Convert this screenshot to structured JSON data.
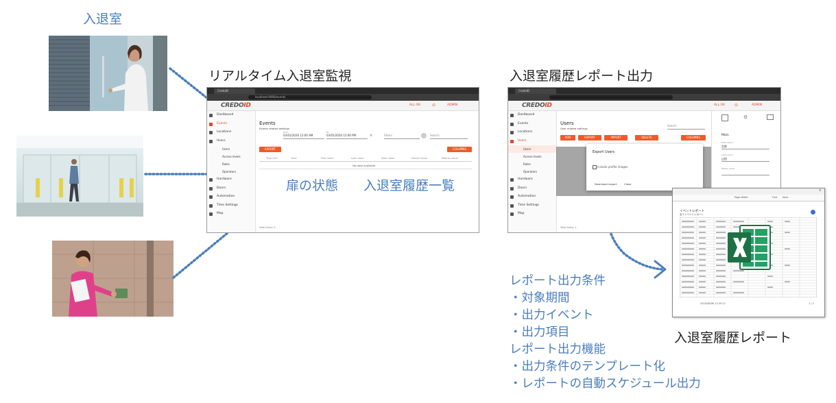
{
  "left_section": {
    "title": "入退室"
  },
  "realtime": {
    "heading": "リアルタイム入退室監視",
    "callout_door": "扉の状態",
    "callout_history": "入退室履歴一覧",
    "browser": {
      "tab_title": "CredoID",
      "url": "localhost:9090/events",
      "logo_main": "CREDO",
      "logo_suffix": "ID",
      "page_title": "Events",
      "subtitle": "Events related settings",
      "from_label": "From",
      "to_label": "To",
      "from_value": "03/01/2020 12:00 AM",
      "to_value": "03/01/2020 12:00 PM",
      "filters_label": "Filters",
      "search_label": "Search",
      "export_label": "EXPORT",
      "columns_label": "COLUMNS",
      "no_data": "No data available",
      "total_items": "Total items: 0",
      "topbar_ok": "ALL OK",
      "topbar_admin": "ADMIN",
      "table_headers": [
        "Type icon",
        "Time",
        "First name",
        "Last name",
        "Door name",
        "Device name",
        "Module name"
      ],
      "nav": [
        "Dashboard",
        "Events",
        "Locations",
        "Users",
        "Users",
        "Access levels",
        "Roles",
        "Operators",
        "Hardware",
        "Doors",
        "Automation",
        "Time Settings",
        "Map"
      ]
    }
  },
  "report": {
    "heading": "入退室履歴レポート出力",
    "browser": {
      "page_title": "Users",
      "subtitle": "User related settings",
      "search_label": "Search",
      "add_label": "ADD",
      "export_label": "EXPORT",
      "import_label": "IMPORT",
      "delete_label": "DELETE",
      "columns_label": "COLUMNS",
      "dialog_title": "Export Users",
      "include_profile": "Include profile images",
      "download_export": "Download export",
      "close": "Close",
      "total_items": "Total items: 1",
      "panel_title": "Main",
      "first_name_label": "First name *",
      "first_name_value": "太郎",
      "last_name_label": "Last name *",
      "last_name_value": "山田",
      "middle_name_label": "Middle name",
      "nav": [
        "Dashboard",
        "Events",
        "Locations",
        "Users",
        "Users",
        "Access levels",
        "Roles",
        "Operators",
        "Hardware",
        "Doors",
        "Automation",
        "Time Settings",
        "Map"
      ]
    },
    "document": {
      "toolbar_page": "Page Width",
      "toolbar_find": "Find",
      "toolbar_next": "Next",
      "title": "イベントレポート",
      "subtitle": "全てイベントレポート",
      "footer_date": "2019/08/08 12:35:12",
      "footer_page": "1 / 2"
    },
    "callout_report": "入退室履歴レポート",
    "conditions": [
      "レポート出力条件",
      "・対象期間",
      "・出力イベント",
      "・出力項目",
      "レポート出力機能",
      "・出力条件のテンプレート化",
      "・レポートの自動スケジュール出力"
    ]
  },
  "colors": {
    "accent_blue": "#4a7ebb",
    "brand_red": "#f05a28",
    "excel_green": "#1e7145"
  }
}
